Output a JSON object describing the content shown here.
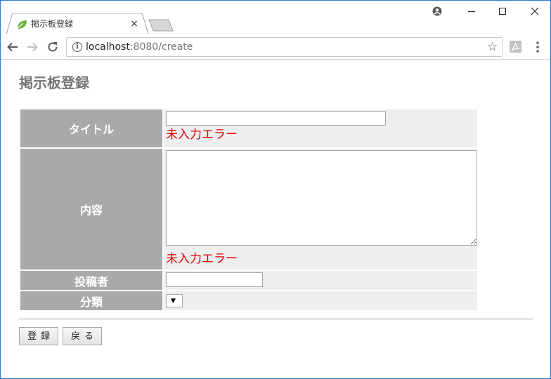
{
  "browser": {
    "tab_title": "掲示板登録",
    "tab_close": "×",
    "url_host": "localhost",
    "url_rest": ":8080/create",
    "icons": {
      "favicon": "leaf-icon",
      "back": "back-arrow-icon",
      "forward": "forward-arrow-icon",
      "reload": "reload-icon",
      "info": "info-icon",
      "star": "star-icon",
      "extension": "pdf-extension-icon",
      "menu": "kebab-menu-icon",
      "account": "account-icon",
      "minimize": "minimize-icon",
      "maximize": "maximize-icon",
      "close": "close-icon"
    }
  },
  "page": {
    "title": "掲示板登録",
    "form": {
      "title_label": "タイトル",
      "title_value": "",
      "title_error": "未入力エラー",
      "content_label": "内容",
      "content_value": "",
      "content_error": "未入力エラー",
      "author_label": "投稿者",
      "author_value": "",
      "category_label": "分類",
      "category_selected": ""
    },
    "buttons": {
      "submit": "登録",
      "back": "戻る"
    }
  },
  "colors": {
    "header_cell_bg": "#a9a9a9",
    "input_cell_bg": "#eeeeee",
    "error_text": "#e00000",
    "title_text": "#777777",
    "window_border": "#2b79d8"
  }
}
